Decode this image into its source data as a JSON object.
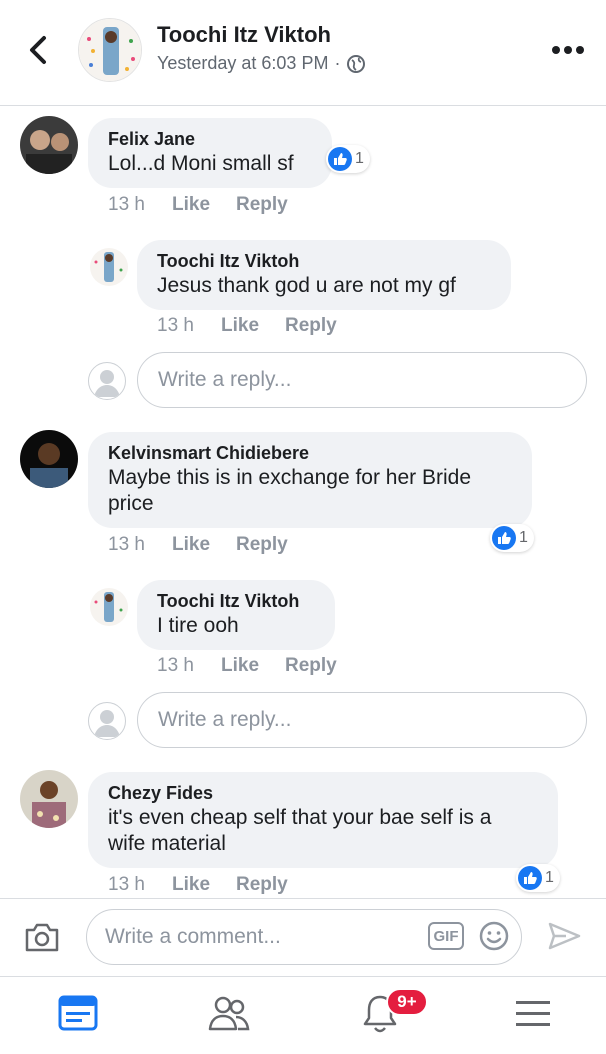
{
  "post": {
    "author": "Toochi Itz Viktoh",
    "timestamp": "Yesterday at 6:03 PM",
    "separator": "·"
  },
  "comments": [
    {
      "name": "Felix Jane",
      "text": "Lol...d Moni small sf",
      "time": "13 h",
      "like_label": "Like",
      "reply_label": "Reply",
      "reactions": "1",
      "replies": [
        {
          "name": "Toochi Itz Viktoh",
          "text": "Jesus thank god u are not my gf",
          "time": "13 h",
          "like_label": "Like",
          "reply_label": "Reply"
        }
      ],
      "reply_placeholder": "Write a reply..."
    },
    {
      "name": "Kelvinsmart Chidiebere",
      "text_line1": "Maybe this is in exchange for her Bride",
      "text_line2": "price",
      "time": "13 h",
      "like_label": "Like",
      "reply_label": "Reply",
      "reactions": "1",
      "replies": [
        {
          "name": "Toochi Itz Viktoh",
          "text": "I tire ooh",
          "time": "13 h",
          "like_label": "Like",
          "reply_label": "Reply"
        }
      ],
      "reply_placeholder": "Write a reply..."
    },
    {
      "name": "Chezy Fides",
      "text_line1": "it's even cheap self that your bae self is a",
      "text_line2": "wife material",
      "time": "13 h",
      "like_label": "Like",
      "reply_label": "Reply",
      "reactions": "1"
    }
  ],
  "composer": {
    "placeholder": "Write a comment...",
    "gif_label": "GIF"
  },
  "tabbar": {
    "notifications_badge": "9+"
  },
  "colors": {
    "accent": "#1877f2",
    "badge": "#e41e3f",
    "muted": "#8d949e",
    "bubble": "#f0f2f5"
  },
  "icons": [
    "back-arrow-icon",
    "globe-icon",
    "more-icon",
    "like-icon",
    "camera-icon",
    "gif-icon",
    "emoji-icon",
    "send-icon",
    "news-feed-icon",
    "friends-icon",
    "notifications-bell-icon",
    "menu-icon"
  ]
}
